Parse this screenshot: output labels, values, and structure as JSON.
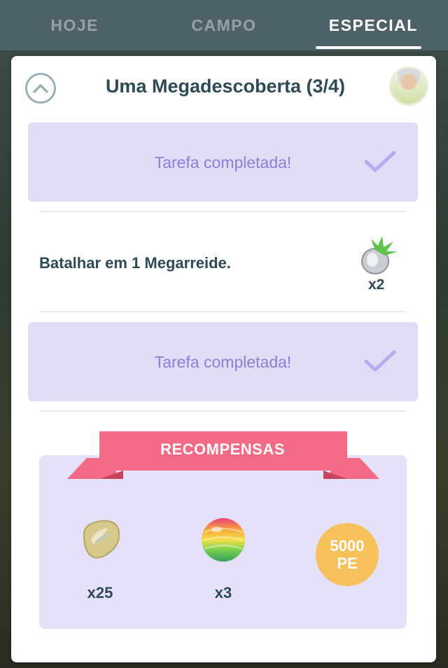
{
  "tabs": [
    {
      "label": "HOJE",
      "active": false
    },
    {
      "label": "CAMPO",
      "active": false
    },
    {
      "label": "ESPECIAL",
      "active": true
    }
  ],
  "research": {
    "title": "Uma Megadescoberta (3/4)",
    "tasks": [
      {
        "status": "completed",
        "label": "Tarefa completada!"
      },
      {
        "status": "pending",
        "label": "Batalhar em 1 Megarreide.",
        "reward_icon": "mega-energy-icon",
        "reward_count": "x2"
      },
      {
        "status": "completed",
        "label": "Tarefa completada!"
      }
    ]
  },
  "rewards": {
    "banner": "RECOMPENSAS",
    "items": [
      {
        "icon": "rare-candy-icon",
        "qty": "x25"
      },
      {
        "icon": "mega-energy-orb-icon",
        "qty": "x3"
      },
      {
        "icon": "xp-badge",
        "line1": "5000",
        "line2": "PE"
      }
    ]
  },
  "colors": {
    "tab_bar": "#4c6168",
    "completed_bg": "#e2dcf6",
    "completed_text": "#8c7fd6",
    "banner": "#f26a84",
    "rewards_bg": "#e5e1f8",
    "xp_badge": "#f6c15b",
    "title_text": "#2d4a56"
  }
}
